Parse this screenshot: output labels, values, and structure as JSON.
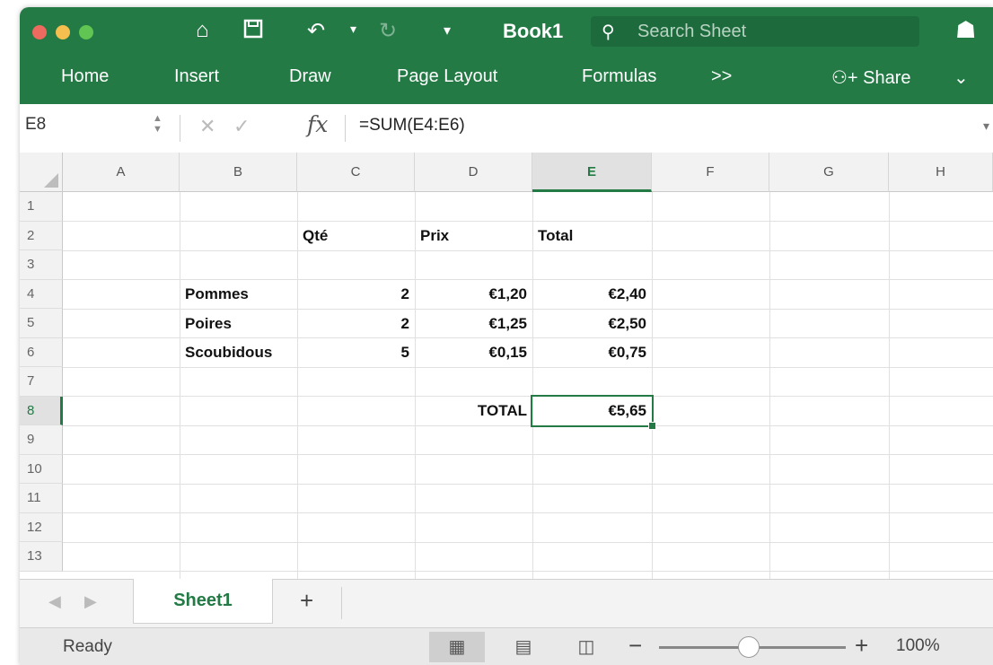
{
  "titlebar": {
    "title": "Book1",
    "search_placeholder": "Search Sheet",
    "accent_color": "#237a45",
    "icons": [
      "close-dot",
      "minimize-dot",
      "zoom-dot",
      "home-icon",
      "save-icon",
      "undo-icon",
      "redo-icon",
      "customize-icon",
      "search-icon",
      "user-icon"
    ]
  },
  "ribbon": {
    "tabs": [
      "Home",
      "Insert",
      "Draw",
      "Page Layout",
      "Formulas",
      ">>"
    ],
    "share_label": "Share"
  },
  "formula_bar": {
    "name_box": "E8",
    "fx_label": "fx",
    "formula": "=SUM(E4:E6)"
  },
  "grid": {
    "columns": [
      "A",
      "B",
      "C",
      "D",
      "E",
      "F",
      "G",
      "H"
    ],
    "rows": [
      "1",
      "2",
      "3",
      "4",
      "5",
      "6",
      "7",
      "8",
      "9",
      "10",
      "11",
      "12",
      "13"
    ],
    "active_cell": "E8",
    "cells": {
      "C2": "Qté",
      "D2": "Prix",
      "E2": "Total",
      "B4": "Pommes",
      "C4": "2",
      "D4": "€1,20",
      "E4": "€2,40",
      "B5": "Poires",
      "C5": "2",
      "D5": "€1,25",
      "E5": "€2,50",
      "B6": "Scoubidous",
      "C6": "5",
      "D6": "€0,15",
      "E6": "€0,75",
      "D8": "TOTAL",
      "E8": "€5,65"
    }
  },
  "sheet_tabs": {
    "active": "Sheet1",
    "add_label": "+"
  },
  "status": {
    "text": "Ready",
    "zoom": "100%",
    "zoom_fraction": 0.5
  }
}
